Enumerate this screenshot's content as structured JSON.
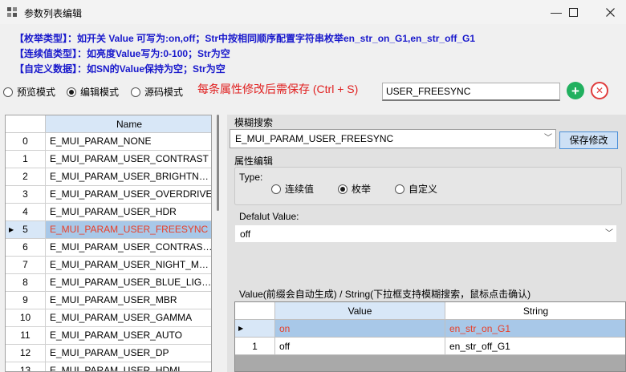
{
  "window": {
    "title": "参数列表编辑",
    "minimize": "—",
    "maximize": "☐",
    "close": "✕"
  },
  "hints": [
    "【枚举类型】：如开关 Value 可写为:on,off；Str中按相同顺序配置字符串枚举en_str_on_G1,en_str_off_G1",
    "【连续值类型】：如亮度Value写为:0-100；Str为空",
    "【自定义数据】：如SN的Value保持为空；Str为空"
  ],
  "modes": [
    {
      "label": "预览模式",
      "selected": false
    },
    {
      "label": "编辑模式",
      "selected": true
    },
    {
      "label": "源码模式",
      "selected": false
    }
  ],
  "warning": "每条属性修改后需保存 (Ctrl + S)",
  "name_input": {
    "value": "USER_FREESYNC"
  },
  "add_button_glyph": "+",
  "delete_button_glyph": "✕",
  "list": {
    "header": "Name",
    "rows": [
      {
        "index": "0",
        "name": "E_MUI_PARAM_NONE"
      },
      {
        "index": "1",
        "name": "E_MUI_PARAM_USER_CONTRAST"
      },
      {
        "index": "2",
        "name": "E_MUI_PARAM_USER_BRIGHTNESS"
      },
      {
        "index": "3",
        "name": "E_MUI_PARAM_USER_OVERDRIVE"
      },
      {
        "index": "4",
        "name": "E_MUI_PARAM_USER_HDR"
      },
      {
        "index": "5",
        "name": "E_MUI_PARAM_USER_FREESYNC"
      },
      {
        "index": "6",
        "name": "E_MUI_PARAM_USER_CONTRAST_RATIO"
      },
      {
        "index": "7",
        "name": "E_MUI_PARAM_USER_NIGHT_MODE"
      },
      {
        "index": "8",
        "name": "E_MUI_PARAM_USER_BLUE_LIGHT"
      },
      {
        "index": "9",
        "name": "E_MUI_PARAM_USER_MBR"
      },
      {
        "index": "10",
        "name": "E_MUI_PARAM_USER_GAMMA"
      },
      {
        "index": "11",
        "name": "E_MUI_PARAM_USER_AUTO"
      },
      {
        "index": "12",
        "name": "E_MUI_PARAM_USER_DP"
      },
      {
        "index": "13",
        "name": "E_MUI_PARAM_USER_HDMI"
      }
    ],
    "selected_index": 5
  },
  "search": {
    "label": "模糊搜索",
    "value": "E_MUI_PARAM_USER_FREESYNC",
    "save_label": "保存修改"
  },
  "props": {
    "label": "属性编辑",
    "type_label": "Type:",
    "types": [
      {
        "label": "连续值",
        "selected": false
      },
      {
        "label": "枚举",
        "selected": true
      },
      {
        "label": "自定义",
        "selected": false
      }
    ],
    "default_label": "Defalut Value:",
    "default_value": "off"
  },
  "values_table": {
    "caption": "Value(前缀会自动生成)  /  String(下拉框支持模糊搜索，鼠标点击确认)",
    "headers": [
      "Value",
      "String"
    ],
    "rows": [
      {
        "index": "",
        "value": "on",
        "string": "en_str_on_G1",
        "selected": true
      },
      {
        "index": "1",
        "value": "off",
        "string": "en_str_off_G1",
        "selected": false
      }
    ]
  },
  "colors": {
    "hint_blue": "#1919cc",
    "warning_red": "#e02020",
    "selection_text": "#e8402a",
    "add_green": "#21b05f",
    "delete_red": "#e03c3c"
  }
}
